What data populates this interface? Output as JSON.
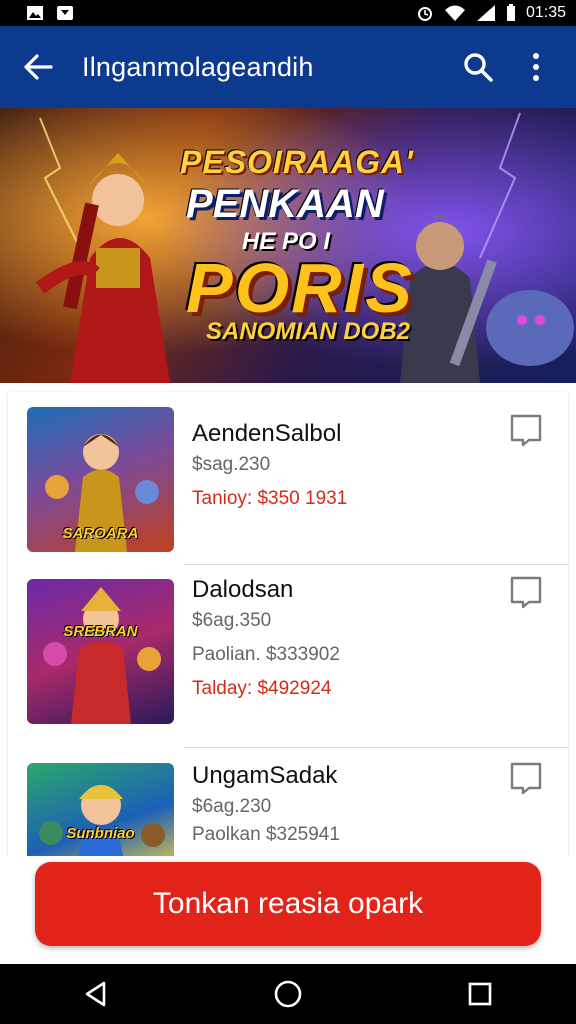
{
  "status_bar": {
    "time": "01:35",
    "left_icons": [
      "notification-image-icon",
      "notification-message-icon"
    ],
    "right_icons": [
      "alarm-icon",
      "wifi-icon",
      "signal-icon",
      "battery-icon"
    ]
  },
  "app_bar": {
    "title": "Ilnganmolageandih",
    "back_icon": "arrow-left-icon",
    "actions": [
      "search-icon",
      "more-vert-icon"
    ]
  },
  "banner": {
    "line1": "PESOIRAAGA'",
    "line2": "PENKAAN",
    "line3": "HE PO I",
    "line4": "PORIS",
    "line5": "SANOMIAN DOB2"
  },
  "list": [
    {
      "name": "AendenSalbol",
      "line1": "$sag.230",
      "line2": "",
      "line3": "Tanioy: $350 1931",
      "thumb_label": "SAROARA",
      "thumb_colors": [
        "#1d6fb8",
        "#e8a23a",
        "#c0401e"
      ]
    },
    {
      "name": "Dalodsan",
      "line1": "$6ag.350",
      "line2": "Paolian. $333902",
      "line3": "Talday: $492924",
      "thumb_label": "SREBRAN",
      "thumb_colors": [
        "#6a2aa8",
        "#e83a2a",
        "#f5c23a"
      ]
    },
    {
      "name": "UngamSadak",
      "line1": "$6ag.230",
      "line2": "Paolkan $325941",
      "line3": "",
      "thumb_label": "Sunbniao",
      "thumb_colors": [
        "#2aa86a",
        "#f5d23a",
        "#1d5fb8"
      ]
    }
  ],
  "cta": {
    "label": "Tonkan reasia opark"
  },
  "colors": {
    "app_bar": "#0b3a8f",
    "cta": "#e2231a",
    "price_red": "#d42a1a"
  },
  "nav_bar": [
    "back-triangle-icon",
    "home-circle-icon",
    "recents-square-icon"
  ]
}
